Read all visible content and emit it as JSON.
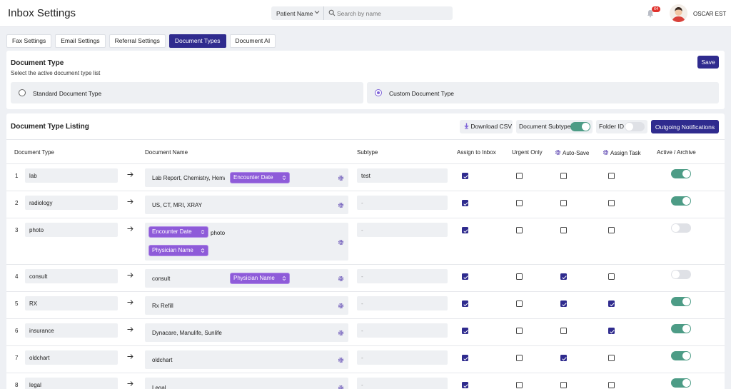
{
  "header": {
    "title": "Inbox Settings",
    "search_filter": "Patient Name",
    "search_placeholder": "Search by name",
    "notification_count": "64",
    "user_name": "OSCAR EST"
  },
  "tabs": [
    {
      "label": "Fax Settings",
      "active": false
    },
    {
      "label": "Email Settings",
      "active": false
    },
    {
      "label": "Referral Settings",
      "active": false
    },
    {
      "label": "Document Types",
      "active": true
    },
    {
      "label": "Document AI",
      "active": false
    }
  ],
  "document_type": {
    "title": "Document Type",
    "subtitle": "Select the active document type list",
    "save_label": "Save",
    "options": [
      {
        "label": "Standard Document Type",
        "selected": false
      },
      {
        "label": "Custom Document Type",
        "selected": true
      }
    ]
  },
  "listing": {
    "title": "Document Type Listing",
    "download_label": "Download CSV",
    "subtype_toggle_label": "Document Subtype",
    "subtype_toggle_on": true,
    "folder_toggle_label": "Folder ID",
    "folder_toggle_on": false,
    "outgoing_label": "Outgoing Notifications",
    "columns": {
      "doc_type": "Document Type",
      "doc_name": "Document Name",
      "subtype": "Subtype",
      "assign_inbox": "Assign to Inbox",
      "urgent": "Urgent Only",
      "auto_save": "Auto-Save",
      "assign_task": "Assign Task",
      "active": "Active / Archive"
    },
    "rows": [
      {
        "num": "1",
        "type": "lab",
        "name_text": "Lab Report, Chemistry, Hema",
        "chips": [
          "Encounter Date"
        ],
        "subtype": "test",
        "inbox": true,
        "urgent": false,
        "autosave": false,
        "task": false,
        "active": true
      },
      {
        "num": "2",
        "type": "radiology",
        "name_text": "US, CT, MRI, XRAY",
        "chips": [],
        "subtype": "-",
        "inbox": true,
        "urgent": false,
        "autosave": false,
        "task": false,
        "active": true
      },
      {
        "num": "3",
        "type": "photo",
        "name_text": "photo",
        "chips": [
          "Encounter Date",
          "Physician Name"
        ],
        "subtype": "-",
        "inbox": true,
        "urgent": false,
        "autosave": false,
        "task": false,
        "active": false
      },
      {
        "num": "4",
        "type": "consult",
        "name_text": "consult",
        "chips": [
          "Physician Name"
        ],
        "subtype": "-",
        "inbox": true,
        "urgent": false,
        "autosave": true,
        "task": false,
        "active": false
      },
      {
        "num": "5",
        "type": "RX",
        "name_text": "Rx Refill",
        "chips": [],
        "subtype": "-",
        "inbox": true,
        "urgent": false,
        "autosave": true,
        "task": true,
        "active": true
      },
      {
        "num": "6",
        "type": "insurance",
        "name_text": "Dynacare, Manulife, Sunlife",
        "chips": [],
        "subtype": "-",
        "inbox": true,
        "urgent": false,
        "autosave": false,
        "task": true,
        "active": true
      },
      {
        "num": "7",
        "type": "oldchart",
        "name_text": "oldchart",
        "chips": [],
        "subtype": "-",
        "inbox": true,
        "urgent": false,
        "autosave": true,
        "task": false,
        "active": true
      },
      {
        "num": "8",
        "type": "legal",
        "name_text": "Legal",
        "chips": [],
        "subtype": "-",
        "inbox": true,
        "urgent": false,
        "autosave": false,
        "task": false,
        "active": true
      }
    ]
  }
}
